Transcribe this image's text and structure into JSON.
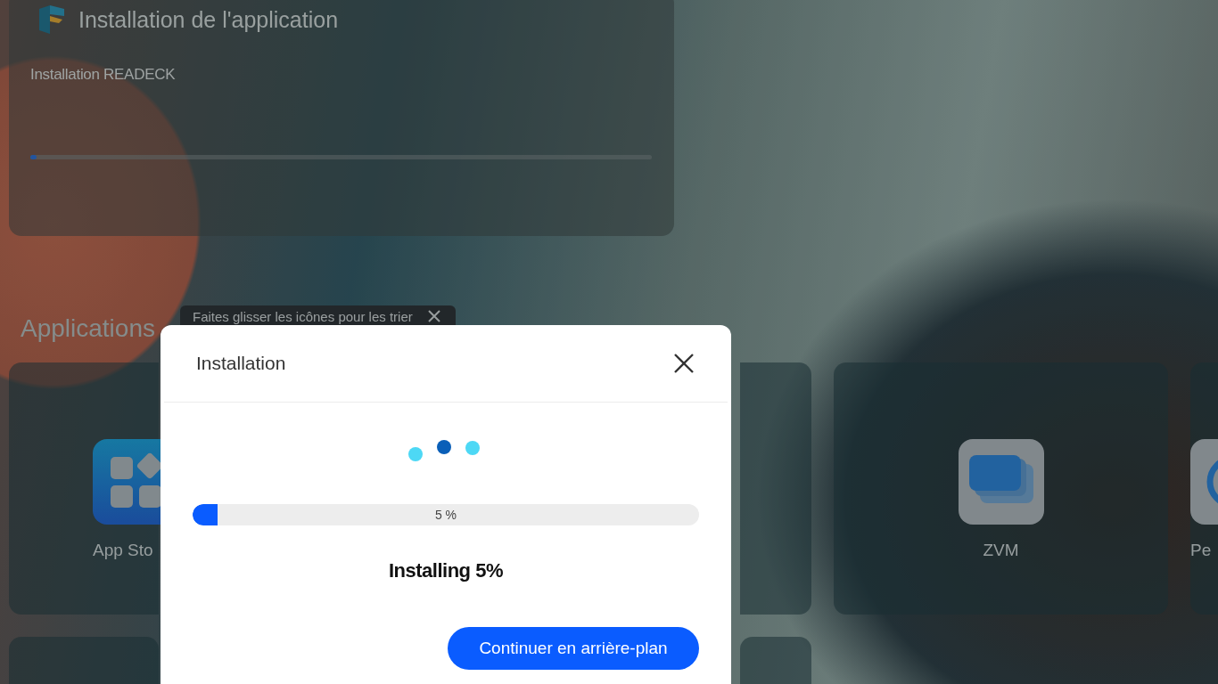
{
  "install_card": {
    "title": "Installation de l'application",
    "subtitle": "Installation READECK",
    "level": 0.01
  },
  "applications": {
    "heading": "Applications",
    "tooltip": "Faites glisser les icônes pour les trier"
  },
  "tiles": [
    {
      "kind": "appstore",
      "label": "App Sto"
    },
    {
      "kind": "hidden"
    },
    {
      "kind": "zvm",
      "label": "ZVM"
    },
    {
      "kind": "circle",
      "label": "Pe"
    }
  ],
  "dialog": {
    "title": "Installation",
    "progress": {
      "level": 0.05,
      "reading": "5 %"
    },
    "status": "Installing 5%",
    "button": "Continuer en arrière-plan"
  }
}
